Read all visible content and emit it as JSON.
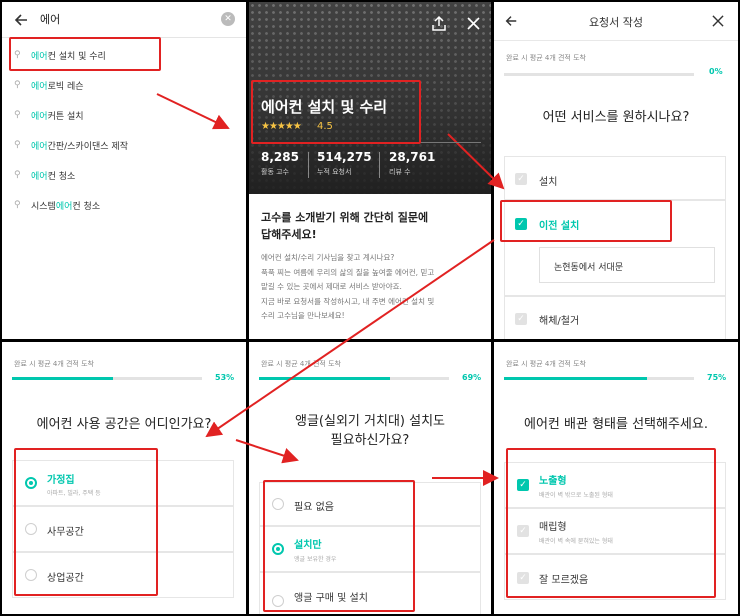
{
  "search": {
    "query": "에어",
    "suggestions": [
      {
        "hl": "에어",
        "rest": "컨 설치 및 수리"
      },
      {
        "hl": "에어",
        "rest": "로빅 레슨"
      },
      {
        "hl": "에어",
        "rest": "커튼 설치"
      },
      {
        "hl": "에어",
        "rest": "간판/스카이댄스 제작"
      },
      {
        "hl": "에어",
        "rest": "컨 청소"
      },
      {
        "pre": "시스템",
        "hl": "에어",
        "rest": "컨 청소"
      }
    ]
  },
  "service": {
    "title": "에어컨 설치 및 수리",
    "rating": "4.5",
    "stats": [
      {
        "value": "8,285",
        "label": "활동 고수"
      },
      {
        "value": "514,275",
        "label": "누적 요청서"
      },
      {
        "value": "28,761",
        "label": "리뷰 수"
      }
    ],
    "intro_title_line1": "고수를 소개받기 위해 간단히 질문에",
    "intro_title_line2": "답해주세요!",
    "intro_lines": [
      "에어컨 설치/수리 기사님을 찾고 계시나요?",
      "푹푹 찌는 여름에 우리의 삶의 질을 높여줄 에어컨, 믿고",
      "맡길 수 있는 곳에서 제대로 서비스 받아야죠.",
      "지금 바로 요청서를 작성하시고, 내 주변 에어컨 설치 및",
      "수리 고수님을 만나보세요!"
    ]
  },
  "request": {
    "header_title": "요청서 작성",
    "progress_label": "완료 시 평균 4개 견적 도착",
    "progress": "0%",
    "progress_value": 0,
    "question": "어떤 서비스를 원하시나요?",
    "options": [
      "설치",
      "이전 설치",
      "해체/철거"
    ],
    "sub_input_value": "논현동에서 서대문"
  },
  "q_space": {
    "progress_label": "완료 시 평균 4개 견적 도착",
    "progress": "53%",
    "progress_value": 0.53,
    "question": "에어컨 사용 공간은 어디인가요?",
    "options": [
      {
        "label": "가정집",
        "sub": "아파트, 빌라, 주택 등"
      },
      {
        "label": "사무공간",
        "sub": ""
      },
      {
        "label": "상업공간",
        "sub": ""
      }
    ]
  },
  "q_angle": {
    "progress_label": "완료 시 평균 4개 견적 도착",
    "progress": "69%",
    "progress_value": 0.69,
    "question_line1": "앵글(실외기 거치대) 설치도",
    "question_line2": "필요하신가요?",
    "options": [
      {
        "label": "필요 없음",
        "sub": ""
      },
      {
        "label": "설치만",
        "sub": "앵글 보유한 경우"
      },
      {
        "label": "앵글 구매 및 설치",
        "sub": ""
      }
    ]
  },
  "q_pipe": {
    "progress_label": "완료 시 평균 4개 견적 도착",
    "progress": "75%",
    "progress_value": 0.75,
    "question": "에어컨 배관 형태를 선택해주세요.",
    "options": [
      {
        "label": "노출형",
        "sub": "배관이 벽 밖으로 노출된 형태"
      },
      {
        "label": "매립형",
        "sub": "배관이 벽 속에 묻혀있는 형태"
      },
      {
        "label": "잘 모르겠음",
        "sub": ""
      }
    ]
  },
  "colors": {
    "accent": "#00c7ae",
    "highlight": "#e12222",
    "star": "#f6c343"
  }
}
